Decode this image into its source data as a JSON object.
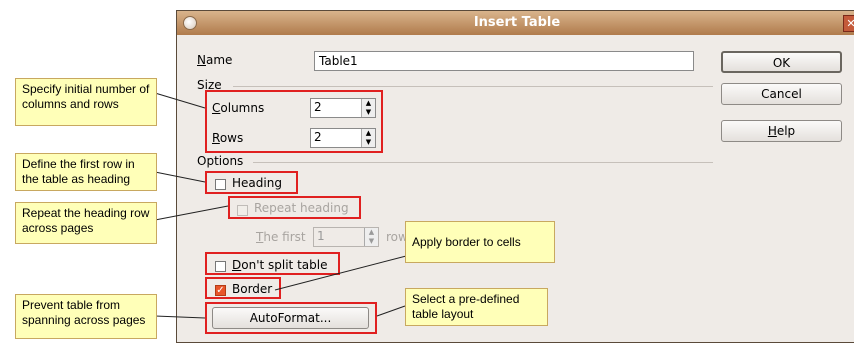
{
  "dialog": {
    "title": "Insert Table",
    "name_label": "Name",
    "name_value": "Table1",
    "size_label": "Size",
    "columns_label": "Columns",
    "columns_value": "2",
    "rows_label": "Rows",
    "rows_value": "2",
    "options_label": "Options",
    "heading_label": "Heading",
    "heading_checked": false,
    "repeat_heading_label": "Repeat heading",
    "repeat_heading_checked": false,
    "the_first_label": "The first",
    "the_first_value": "1",
    "rows_suffix": "row",
    "dont_split_label": "Don't split table",
    "dont_split_checked": false,
    "border_label": "Border",
    "border_checked": true,
    "autoformat_label": "AutoFormat...",
    "ok_label": "OK",
    "cancel_label": "Cancel",
    "help_label": "Help"
  },
  "callouts": {
    "columns_rows": "Specify initial number of columns and rows",
    "heading": "Define the first row in the table as heading",
    "repeat": "Repeat the heading row across pages",
    "border": "Apply border to cells",
    "split": "Prevent table from spanning across pages",
    "autoformat": "Select a pre-defined table layout"
  },
  "colors": {
    "annotation_box": "#e02020",
    "callout_fill": "#ffffb8",
    "titlebar": "#b07b4c",
    "checkbox_checked": "#e8552a"
  }
}
